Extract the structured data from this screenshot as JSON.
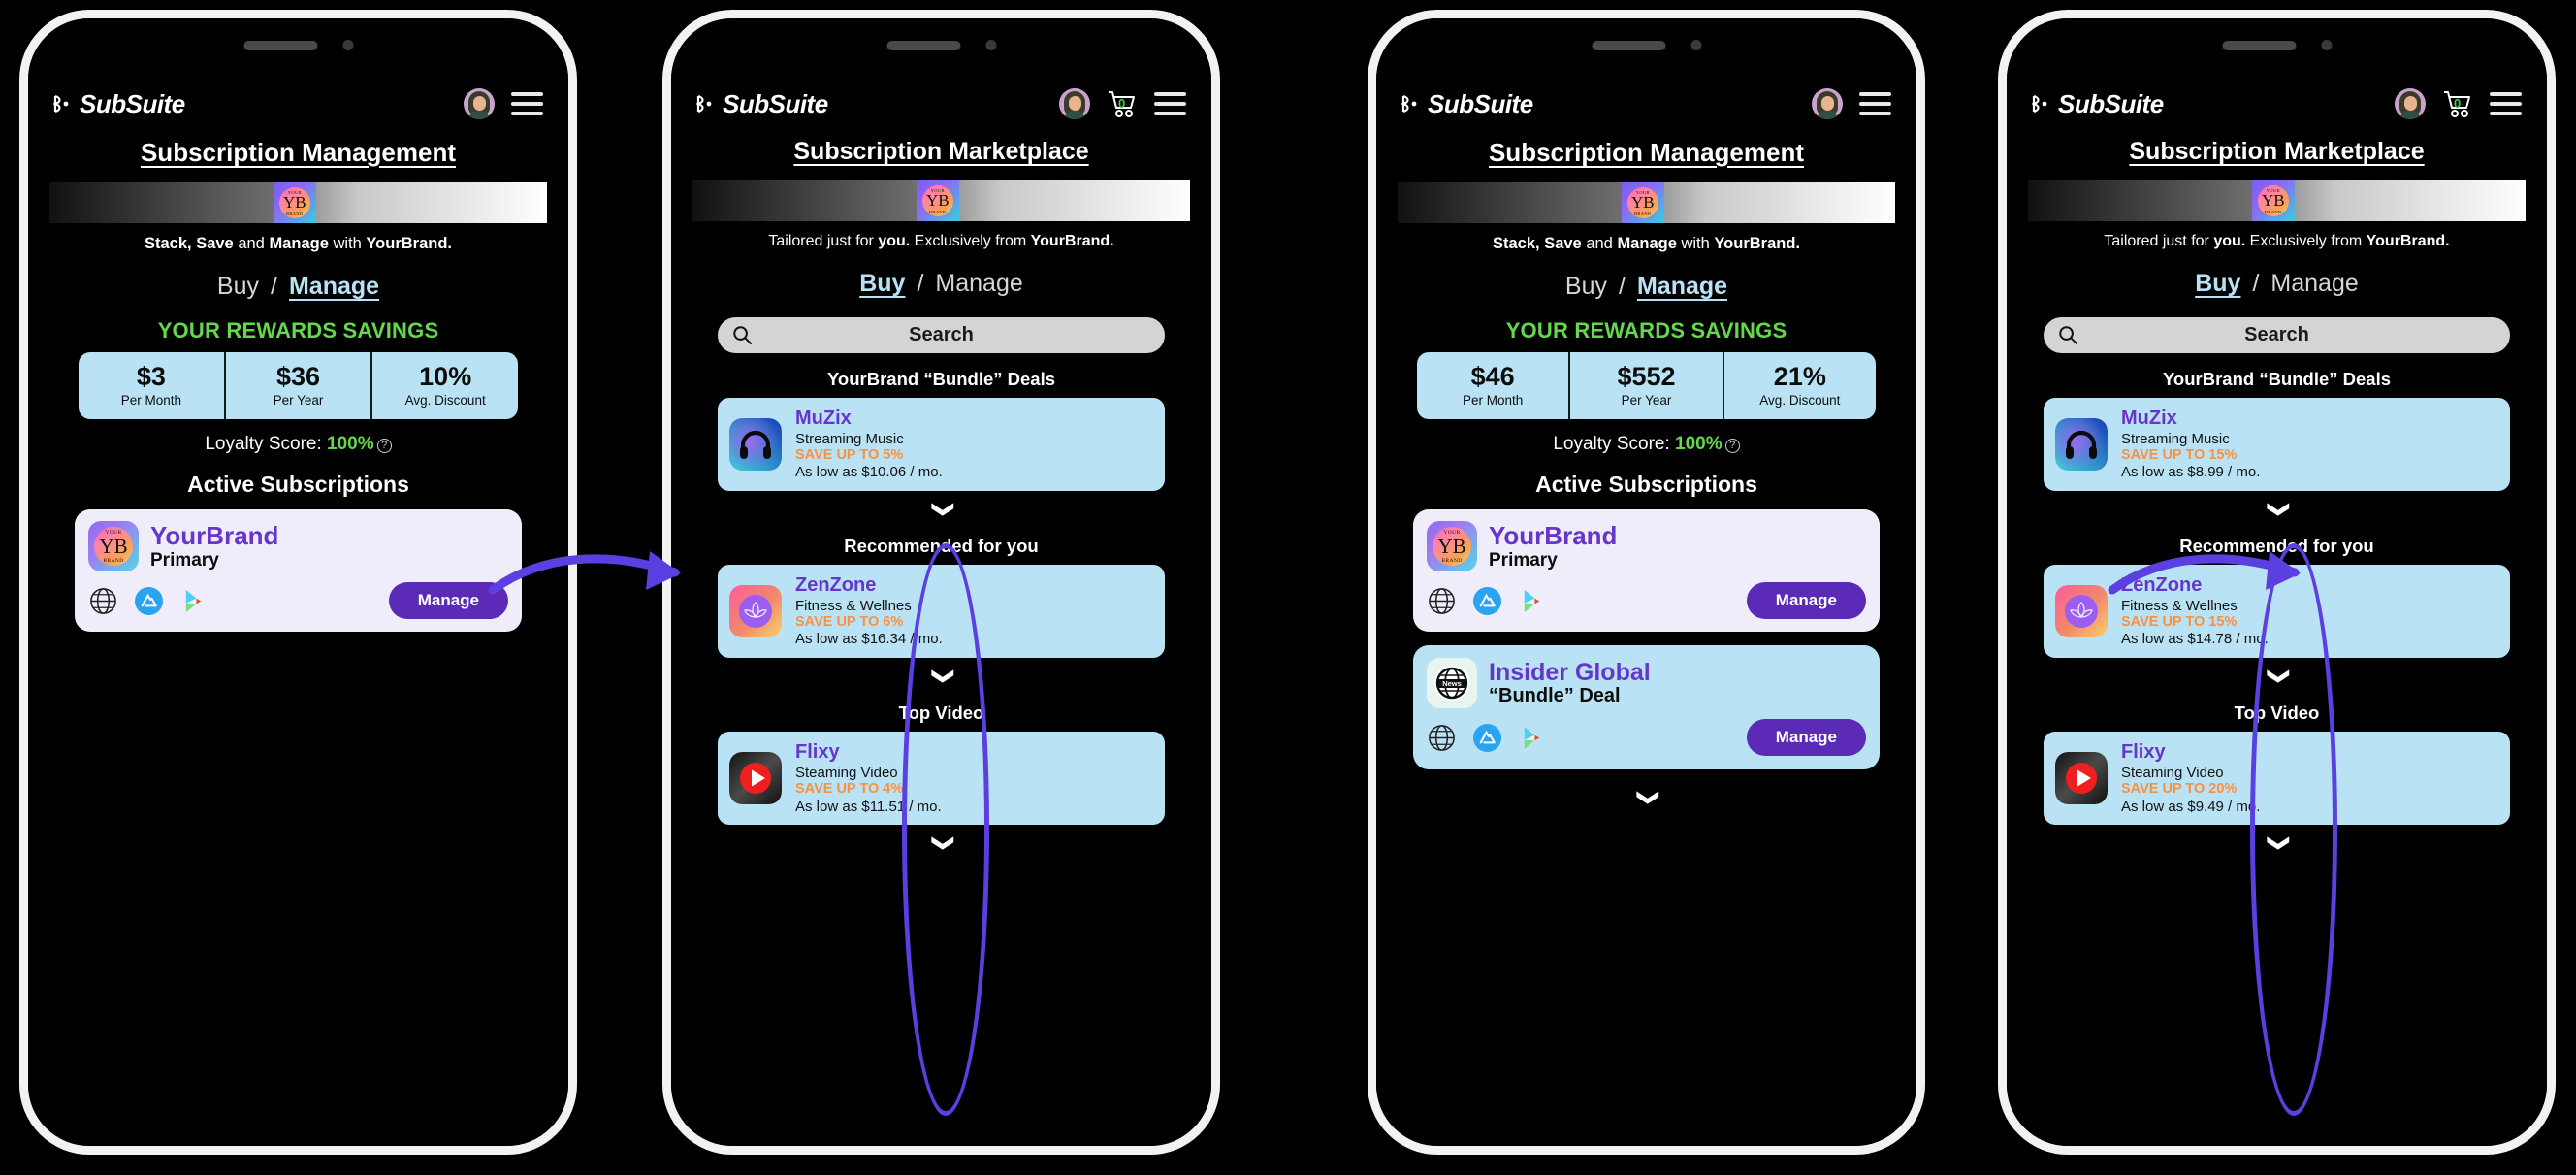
{
  "brand": {
    "app_name": "SubSuite",
    "logo_icon": "subsuite-logo-icon",
    "brand_name": "YourBrand",
    "yb_initials": "YB",
    "yb_top": "YOUR",
    "yb_bottom": "BRAND",
    "accent_purple": "#5b2bb8",
    "accent_green": "#63d94a",
    "accent_orange": "#f99141",
    "card_blue": "#b9e3f4",
    "link_blue": "#b9e2f7",
    "annotation_purple": "#5b3fe0"
  },
  "header": {
    "avatar_icon": "avatar",
    "cart_icon": "shopping-cart-icon",
    "cart_count": "0",
    "menu_icon": "hamburger-menu-icon"
  },
  "common": {
    "manage_title": "Subscription Management",
    "marketplace_title": "Subscription Marketplace",
    "manage_tagline_1": "Stack,",
    "manage_tagline_2": "Save",
    "manage_tagline_and": " and ",
    "manage_tagline_3": "Manage",
    "manage_tagline_4": " with ",
    "manage_tagline_brand": "YourBrand.",
    "market_tagline_1": "Tailored just for ",
    "market_tagline_2": "you.",
    "market_tagline_3": " Exclusively from ",
    "market_tagline_brand": "YourBrand.",
    "toggle_buy": "Buy",
    "toggle_sep": "/",
    "toggle_manage": "Manage",
    "rewards_title": "YOUR REWARDS SAVINGS",
    "label_per_month": "Per Month",
    "label_per_year": "Per Year",
    "label_avg_discount": "Avg. Discount",
    "loyalty_label": "Loyalty Score: ",
    "loyalty_value": "100%",
    "loyalty_help_icon": "help-circle-icon",
    "active_subs_title": "Active Subscriptions",
    "search_placeholder": "Search",
    "search_icon": "search-icon",
    "chevron_icon": "chevron-down-icon",
    "manage_button": "Manage",
    "globe_icon": "globe-icon",
    "appstore_icon": "app-store-icon",
    "playstore_icon": "google-play-icon",
    "heading_bundle_deals": "YourBrand “Bundle” Deals",
    "heading_recommended": "Recommended for you",
    "heading_top_video": "Top Video"
  },
  "phones": [
    {
      "id": "phone-1-manage-before",
      "type": "manage",
      "title": "Subscription Management",
      "active_tab": "Manage",
      "has_cart": false,
      "rewards": [
        {
          "value": "$3",
          "label": "Per Month"
        },
        {
          "value": "$36",
          "label": "Per Year"
        },
        {
          "value": "10%",
          "label": "Avg. Discount"
        }
      ],
      "loyalty": "100%",
      "subscriptions": [
        {
          "name": "YourBrand",
          "plan": "Primary",
          "icon": "yourbrand-icon",
          "button": "Manage",
          "platforms": [
            "globe-icon",
            "app-store-icon",
            "google-play-icon"
          ]
        }
      ]
    },
    {
      "id": "phone-2-marketplace-before",
      "type": "market",
      "title": "Subscription Marketplace",
      "active_tab": "Buy",
      "has_cart": true,
      "cart_count": "0",
      "search": "Search",
      "sections": [
        {
          "heading": "YourBrand “Bundle” Deals",
          "card": {
            "name": "MuZix",
            "category": "Streaming Music",
            "save": "SAVE UP TO 5%",
            "price": "As low as $10.06 / mo.",
            "icon": "headphones-icon"
          }
        },
        {
          "heading": "Recommended for you",
          "card": {
            "name": "ZenZone",
            "category": "Fitness & Wellnes",
            "save": "SAVE UP TO 6%",
            "price": "As low as $16.34 / mo.",
            "icon": "lotus-icon"
          }
        },
        {
          "heading": "Top Video",
          "card": {
            "name": "Flixy",
            "category": "Steaming Video",
            "save": "SAVE UP TO 4%",
            "price": "As low as $11.51 / mo.",
            "icon": "play-button-icon"
          }
        }
      ]
    },
    {
      "id": "phone-3-manage-after",
      "type": "manage",
      "title": "Subscription Management",
      "active_tab": "Manage",
      "has_cart": false,
      "rewards": [
        {
          "value": "$46",
          "label": "Per Month"
        },
        {
          "value": "$552",
          "label": "Per Year"
        },
        {
          "value": "21%",
          "label": "Avg. Discount"
        }
      ],
      "loyalty": "100%",
      "subscriptions": [
        {
          "name": "YourBrand",
          "plan": "Primary",
          "icon": "yourbrand-icon",
          "button": "Manage",
          "platforms": [
            "globe-icon",
            "app-store-icon",
            "google-play-icon"
          ]
        },
        {
          "name": "Insider Global",
          "plan": "“Bundle” Deal",
          "icon": "news-globe-icon",
          "button": "Manage",
          "platforms": [
            "globe-icon",
            "app-store-icon",
            "google-play-icon"
          ]
        }
      ]
    },
    {
      "id": "phone-4-marketplace-after",
      "type": "market",
      "title": "Subscription Marketplace",
      "active_tab": "Buy",
      "has_cart": true,
      "cart_count": "0",
      "search": "Search",
      "sections": [
        {
          "heading": "YourBrand “Bundle” Deals",
          "card": {
            "name": "MuZix",
            "category": "Streaming Music",
            "save": "SAVE UP TO 15%",
            "price": "As low as $8.99 / mo.",
            "icon": "headphones-icon"
          }
        },
        {
          "heading": "Recommended for you",
          "card": {
            "name": "ZenZone",
            "category": "Fitness & Wellnes",
            "save": "SAVE UP TO 15%",
            "price": "As low as $14.78 / mo.",
            "icon": "lotus-icon"
          }
        },
        {
          "heading": "Top Video",
          "card": {
            "name": "Flixy",
            "category": "Steaming Video",
            "save": "SAVE UP TO 20%",
            "price": "As low as $9.49 / mo.",
            "icon": "play-button-icon"
          }
        }
      ]
    }
  ],
  "annotations": {
    "arrow_1_icon": "curved-arrow-icon",
    "arrow_2_icon": "curved-arrow-icon",
    "ellipse_1_icon": "highlight-ellipse",
    "ellipse_2_icon": "highlight-ellipse"
  }
}
